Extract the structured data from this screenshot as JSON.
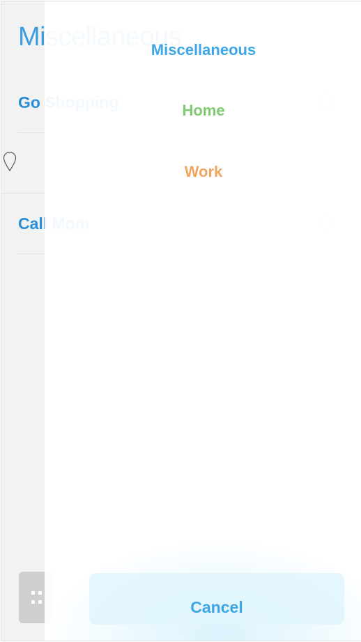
{
  "list": {
    "title": "Miscellaneous",
    "items": [
      {
        "label": "Go Shopping"
      },
      {
        "label": ""
      },
      {
        "label": "Call Mom"
      }
    ]
  },
  "sheet": {
    "categories": [
      {
        "label": "Miscellaneous",
        "color": "#3ea6e4"
      },
      {
        "label": "Home",
        "color": "#7ecb72"
      },
      {
        "label": "Work",
        "color": "#efa55f"
      }
    ],
    "cancel_label": "Cancel"
  },
  "icons": {
    "location": "location-pin-icon",
    "add": "grid-dots-icon"
  }
}
